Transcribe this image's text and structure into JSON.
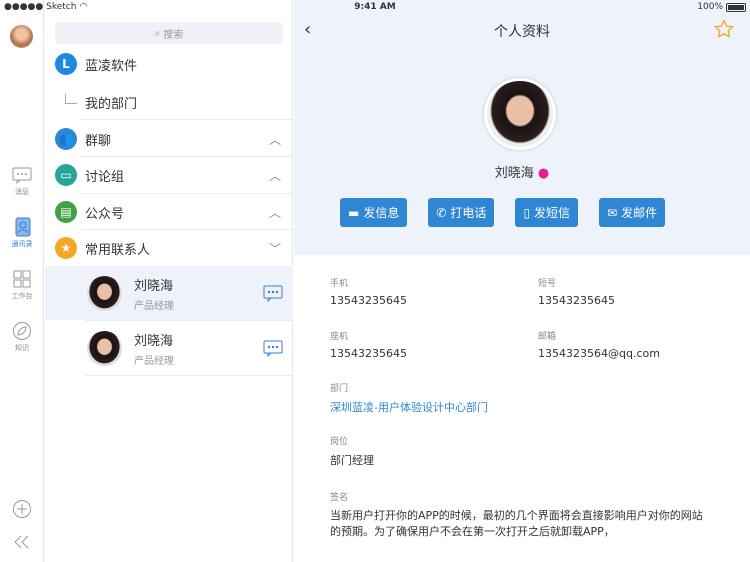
{
  "status": {
    "carrier": "●●●●● Sketch",
    "time": "9:41 AM",
    "battery": "100%"
  },
  "rail": {
    "items": [
      {
        "label": "消息"
      },
      {
        "label": "通讯录"
      },
      {
        "label": "工作台"
      },
      {
        "label": "知识"
      }
    ]
  },
  "list": {
    "search_placeholder": "搜索",
    "org": {
      "initial": "L",
      "name": "蓝凌软件",
      "sub": "我的部门"
    },
    "groups": [
      {
        "label": "群聊",
        "color": "#2f87d4"
      },
      {
        "label": "讨论组",
        "color": "#26a69a"
      },
      {
        "label": "公众号",
        "color": "#43a047"
      },
      {
        "label": "常用联系人",
        "color": "#f5a623"
      }
    ],
    "contacts": [
      {
        "name": "刘晓海",
        "title": "产品经理"
      },
      {
        "name": "刘晓海",
        "title": "产品经理"
      }
    ]
  },
  "detail": {
    "title": "个人资料",
    "name": "刘晓海",
    "buttons": [
      "发信息",
      "打电话",
      "发短信",
      "发邮件"
    ],
    "fields": {
      "mobile": {
        "label": "手机",
        "value": "13543235645"
      },
      "short": {
        "label": "短号",
        "value": "13543235645"
      },
      "landline": {
        "label": "座机",
        "value": "13543235645"
      },
      "email": {
        "label": "邮箱",
        "value": "1354323564@qq.com"
      },
      "dept": {
        "label": "部门",
        "value": "深圳蓝凌-用户体验设计中心部门"
      },
      "position": {
        "label": "岗位",
        "value": "部门经理"
      },
      "signature": {
        "label": "签名",
        "value": "当新用户打开你的APP的时候，最初的几个界面将会直接影响用户对你的网站的预期。为了确保用户不会在第一次打开之后就卸载APP，"
      }
    }
  }
}
